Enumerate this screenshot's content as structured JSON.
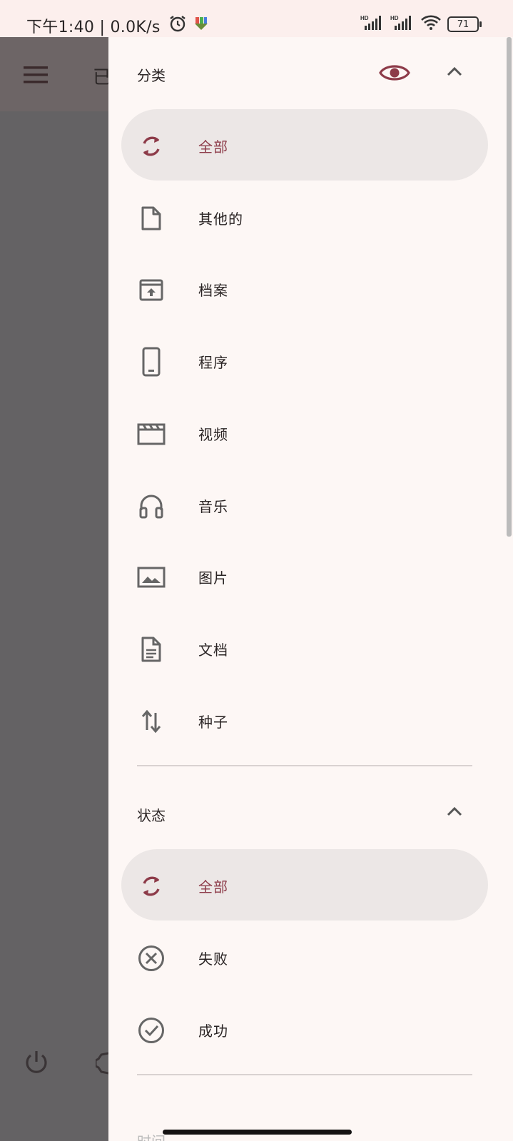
{
  "status_bar": {
    "time_speed": "下午1:40 | 0.0K/s",
    "battery": "71",
    "signal1_label": "HD",
    "signal2_label": "HD"
  },
  "background_app": {
    "title_fragment": "已"
  },
  "categories": {
    "title": "分类",
    "items": [
      {
        "label": "全部",
        "icon": "refresh-icon",
        "selected": true
      },
      {
        "label": "其他的",
        "icon": "file-icon",
        "selected": false
      },
      {
        "label": "档案",
        "icon": "archive-icon",
        "selected": false
      },
      {
        "label": "程序",
        "icon": "phone-icon",
        "selected": false
      },
      {
        "label": "视频",
        "icon": "movie-icon",
        "selected": false
      },
      {
        "label": "音乐",
        "icon": "headphones-icon",
        "selected": false
      },
      {
        "label": "图片",
        "icon": "image-icon",
        "selected": false
      },
      {
        "label": "文档",
        "icon": "document-icon",
        "selected": false
      },
      {
        "label": "种子",
        "icon": "swap-vertical-icon",
        "selected": false
      }
    ]
  },
  "status": {
    "title": "状态",
    "items": [
      {
        "label": "全部",
        "icon": "refresh-icon",
        "selected": true
      },
      {
        "label": "失败",
        "icon": "cancel-circle-icon",
        "selected": false
      },
      {
        "label": "成功",
        "icon": "check-circle-icon",
        "selected": false
      }
    ]
  },
  "next_section_partial": "时间",
  "colors": {
    "accent": "#8d3b49",
    "drawer_bg": "#fdf7f5",
    "selected_bg": "#ece7e6",
    "scrim": "#646264"
  }
}
